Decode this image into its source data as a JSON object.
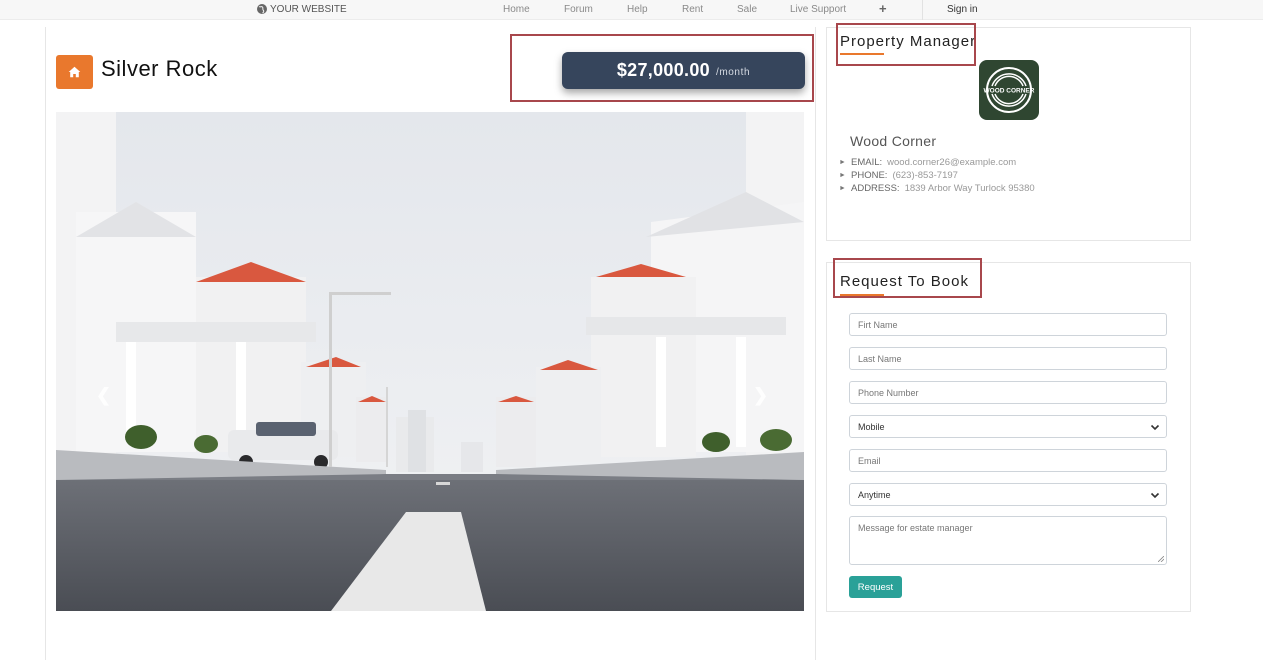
{
  "navbar": {
    "brand": "YOUR WEBSITE",
    "items": [
      "Home",
      "Forum",
      "Help",
      "Rent",
      "Sale",
      "Live Support"
    ],
    "plus": "+",
    "signin": "Sign in"
  },
  "property": {
    "title": "Silver Rock",
    "price": "$27,000.00",
    "period": "/month",
    "icon": "home-icon"
  },
  "manager": {
    "section_title": "Property Manager",
    "logo_text": "WOOD CORNER",
    "name": "Wood Corner",
    "email_label": "EMAIL:",
    "email": "wood.corner26@example.com",
    "phone_label": "PHONE:",
    "phone": "(623)-853-7197",
    "address_label": "ADDRESS:",
    "address": "1839 Arbor Way Turlock 95380"
  },
  "booking": {
    "section_title": "Request To Book",
    "first_name_placeholder": "Firt Name",
    "last_name_placeholder": "Last Name",
    "phone_placeholder": "Phone Number",
    "phone_type": "Mobile",
    "email_placeholder": "Email",
    "time_select": "Anytime",
    "message_placeholder": "Message for estate manager",
    "submit_label": "Request"
  },
  "colors": {
    "accent_orange": "#e9782d",
    "price_bg": "#36455c",
    "highlight_border": "#a8474c",
    "button_teal": "#2aa198",
    "logo_bg": "#2f4631"
  }
}
